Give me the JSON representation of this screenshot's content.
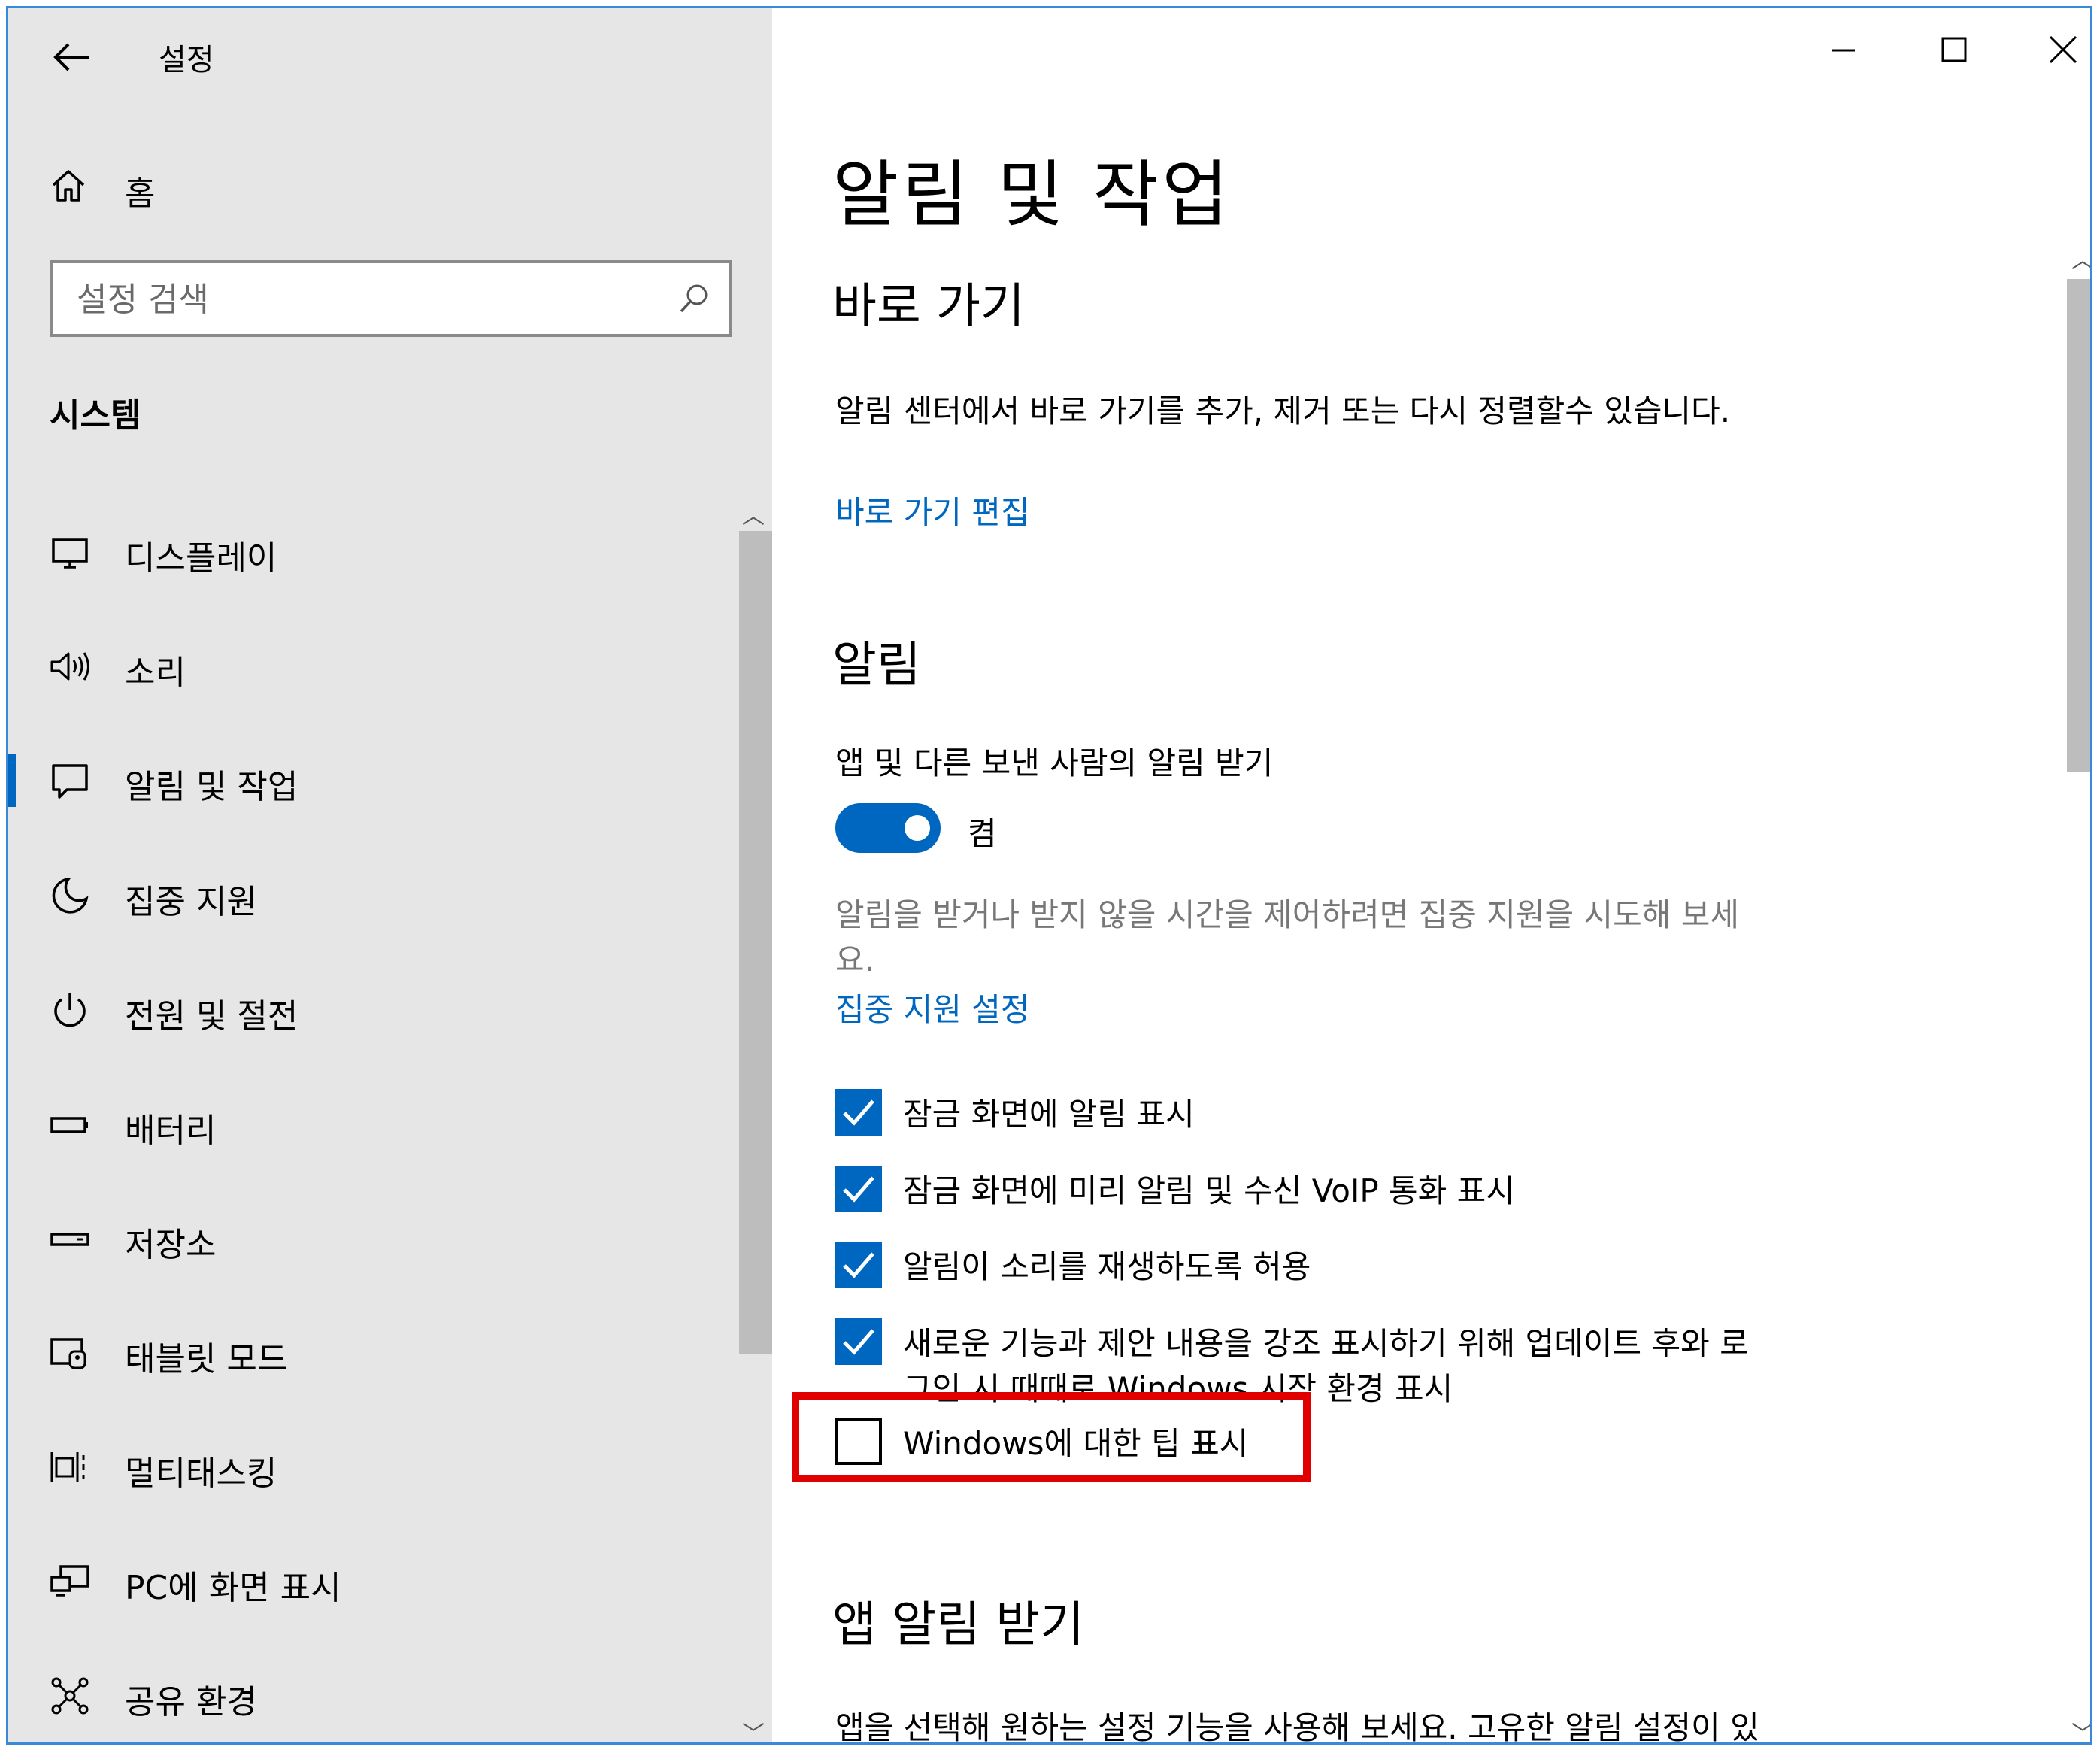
{
  "app": {
    "title": "설정",
    "home_label": "홈",
    "back_icon": "back-arrow-icon"
  },
  "search": {
    "placeholder": "설정 검색"
  },
  "nav": {
    "group_title": "시스템",
    "items": [
      {
        "label": "디스플레이",
        "icon": "monitor-icon"
      },
      {
        "label": "소리",
        "icon": "speaker-icon"
      },
      {
        "label": "알림 및 작업",
        "icon": "notification-icon",
        "selected": true
      },
      {
        "label": "집중 지원",
        "icon": "moon-icon"
      },
      {
        "label": "전원 및 절전",
        "icon": "power-icon"
      },
      {
        "label": "배터리",
        "icon": "battery-icon"
      },
      {
        "label": "저장소",
        "icon": "storage-icon"
      },
      {
        "label": "태블릿 모드",
        "icon": "tablet-icon"
      },
      {
        "label": "멀티태스킹",
        "icon": "multitasking-icon"
      },
      {
        "label": "PC에 화면 표시",
        "icon": "project-icon"
      },
      {
        "label": "공유 환경",
        "icon": "share-icon"
      }
    ]
  },
  "window_controls": {
    "minimize": "minimize-icon",
    "maximize": "maximize-icon",
    "close": "close-icon"
  },
  "main": {
    "page_title": "알림 및 작업",
    "quick_actions": {
      "heading": "바로 가기",
      "description": "알림 센터에서 바로 가기를 추가, 제거 또는 다시 정렬할수 있습니다.",
      "edit_link": "바로 가기 편집"
    },
    "notifications": {
      "heading": "알림",
      "toggle_label": "앱 및 다른 보낸 사람의 알림 받기",
      "toggle_state": "켬",
      "toggle_on": true,
      "focus_hint_line1": "알림을 받거나 받지 않을 시간을 제어하려면 집중 지원을 시도해 보세",
      "focus_hint_line2": "요.",
      "focus_link": "집중 지원 설정",
      "checkboxes": [
        {
          "label": "잠금 화면에 알림 표시",
          "checked": true
        },
        {
          "label": "잠금 화면에 미리 알림 및 수신 VoIP 통화 표시",
          "checked": true
        },
        {
          "label": "알림이 소리를 재생하도록 허용",
          "checked": true
        },
        {
          "label_line1": "새로운 기능과 제안 내용을 강조 표시하기 위해 업데이트 후와 로",
          "label_line2": "그인 시 때때로 Windows 시작 환경 표시",
          "checked": true
        },
        {
          "label": "Windows에 대한 팁 표시",
          "checked": false
        }
      ]
    },
    "app_notifications": {
      "heading": "앱 알림 받기",
      "description": "앱을 선택해 원하는 설정 기능을 사용해 보세요. 고유한 알림 설정이 있"
    }
  },
  "colors": {
    "accent": "#0067c0",
    "sidebar_bg": "#e6e6e6",
    "highlight_box": "#e00000",
    "window_border": "#3a8ad9"
  }
}
